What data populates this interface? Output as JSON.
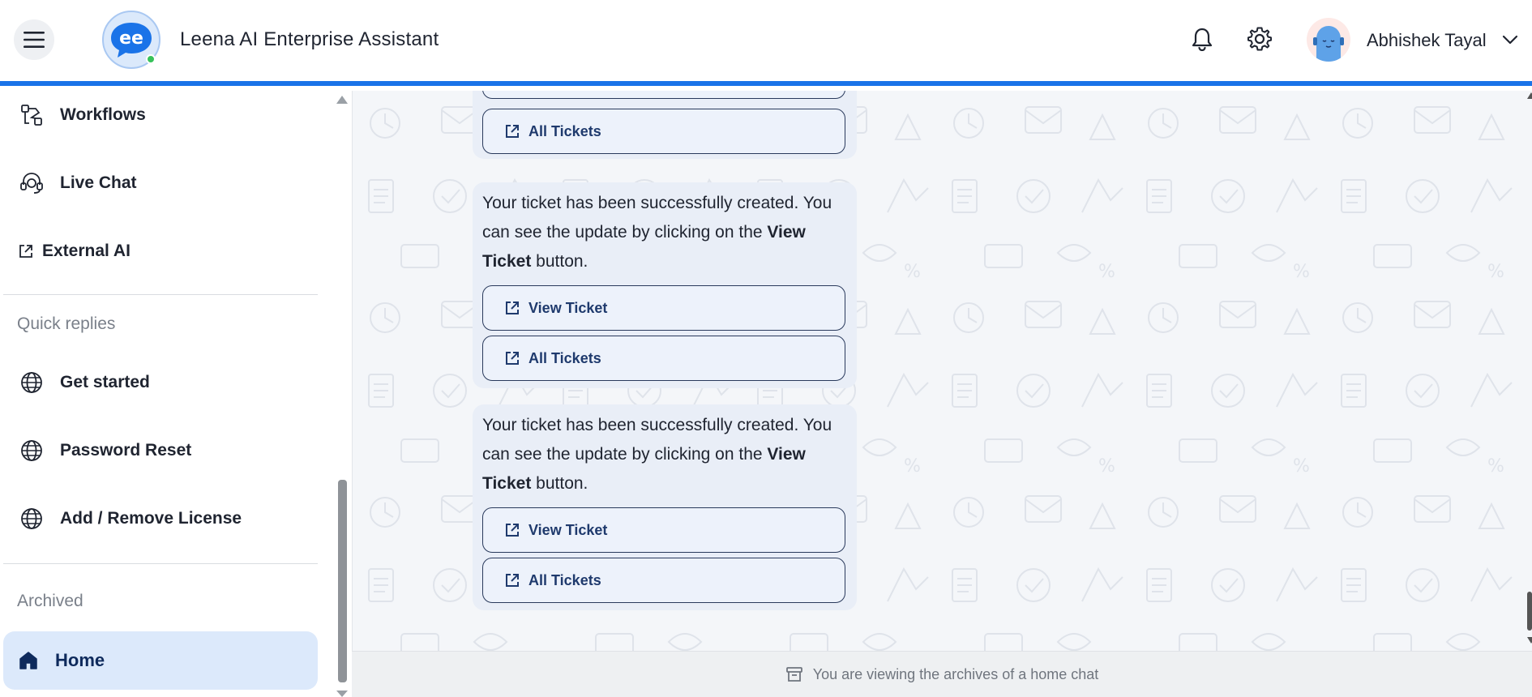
{
  "header": {
    "app_title": "Leena AI Enterprise Assistant",
    "user_name": "Abhishek Tayal",
    "logo_text": "ee"
  },
  "sidebar": {
    "items": [
      {
        "label": "Workflows",
        "icon": "workflow-icon"
      },
      {
        "label": "Live Chat",
        "icon": "headset-icon"
      },
      {
        "label": "External AI",
        "icon": "external-link-icon"
      }
    ],
    "quick_replies_label": "Quick replies",
    "quick_replies": [
      {
        "label": "Get started",
        "icon": "globe-icon"
      },
      {
        "label": "Password Reset",
        "icon": "globe-icon"
      },
      {
        "label": "Add / Remove License",
        "icon": "globe-icon"
      }
    ],
    "archived_label": "Archived",
    "home_label": "Home"
  },
  "chat": {
    "messages": [
      {
        "buttons": [
          "All Tickets"
        ]
      },
      {
        "text_pre": "Your ticket has been successfully created. You can see the update by clicking on the ",
        "text_bold": "View Ticket",
        "text_post": " button.",
        "buttons": [
          "View Ticket",
          "All Tickets"
        ]
      },
      {
        "text_pre": "Your ticket has been successfully created. You can see the update by clicking on the ",
        "text_bold": "View Ticket",
        "text_post": " button.",
        "buttons": [
          "View Ticket",
          "All Tickets"
        ]
      }
    ]
  },
  "footer": {
    "text": "You are viewing the archives of a home chat",
    "icon": "archive-icon"
  },
  "colors": {
    "accent": "#1a73e8",
    "home_highlight": "#dce9fb",
    "chat_bg": "#f4f6f9",
    "button_text": "#1f3a6d"
  }
}
